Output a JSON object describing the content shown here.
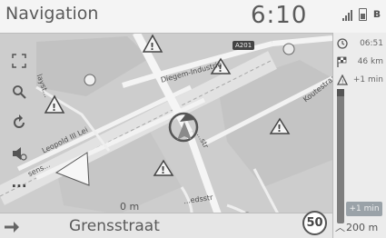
{
  "header": {
    "title": "Navigation",
    "clock": "6:10"
  },
  "right_panel": {
    "arrival_time": "06:51",
    "distance_to_destination": "46 km",
    "traffic_delay": "+1 min",
    "traffic_tag": "+1 min",
    "next_distance": "200 m"
  },
  "map": {
    "road_labels": {
      "diegem": "Diegem-Industrie",
      "a201": "A201",
      "leopold": "Leopold III Lei",
      "koutestr": "Koutestraat",
      "laystr": "layst...",
      "ijsstr": "...str",
      "edsstr": "...edsstr",
      "senss": "sens..."
    },
    "distance_to_turn": "0 m",
    "speed_limit": "50",
    "current_street": "Grensstraat"
  },
  "left_controls": {
    "more_label": "..."
  },
  "icons": {
    "header": [
      "signal-icon",
      "battery-icon",
      "bluetooth-icon"
    ],
    "right_panel": [
      "clock-icon",
      "checkered-flag-icon",
      "warning-icon"
    ],
    "left": [
      "expand-icon",
      "search-icon",
      "reroute-icon",
      "volume-icon",
      "more-icon"
    ]
  },
  "colors": {
    "map_bg": "#cfcfcf",
    "road": "#f2f2f2",
    "car_arrow": "#f5f5f5",
    "panel": "#ececec"
  }
}
